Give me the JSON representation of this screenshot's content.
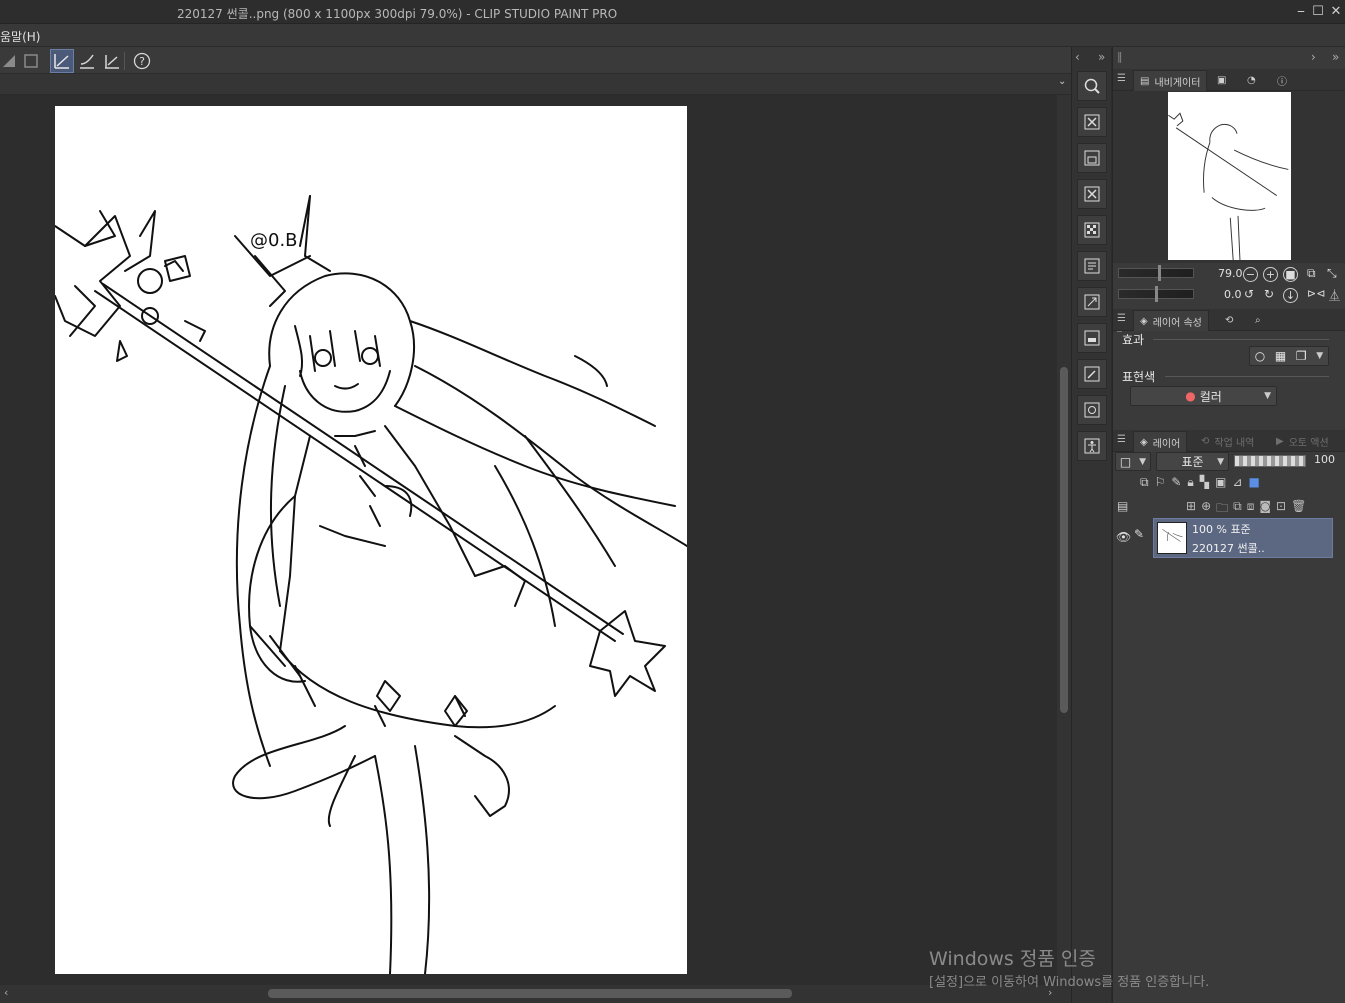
{
  "window": {
    "title": "220127 썬콜..png (800 x 1100px 300dpi 79.0%)  - CLIP STUDIO PAINT PRO",
    "minimize_glyph": "⎯",
    "maximize_glyph": "☐",
    "close_glyph": "✕"
  },
  "menu": {
    "help_label": "움말(H)"
  },
  "toolbar": {
    "icons": [
      "ruler-edge-icon",
      "frame-icon",
      "snap-to-ruler-icon",
      "snap-to-special-ruler-icon",
      "snap-to-grid-icon",
      "help-icon"
    ]
  },
  "navigator": {
    "tabs": [
      {
        "label": "내비게이터",
        "active": true
      },
      {
        "label": "",
        "active": false
      },
      {
        "label": "",
        "active": false
      },
      {
        "label": "",
        "active": false
      }
    ],
    "zoom_value": "79.0",
    "rotation_value": "0.0"
  },
  "layer_property": {
    "tab_label": "레이어 속성",
    "effect_label": "효과",
    "expression_color_label": "표현색",
    "expression_color_value": "컬러"
  },
  "layer_panel": {
    "tabs": [
      {
        "label": "레이어",
        "active": true
      },
      {
        "label": "작업 내역",
        "active": false
      },
      {
        "label": "오토 액션",
        "active": false
      }
    ],
    "blend_mode": "표준",
    "opacity": "100",
    "layers": [
      {
        "opacity_mode": "100 % 표준",
        "name": "220127 썬콜..",
        "visible": true,
        "selected": true
      }
    ]
  },
  "watermark": {
    "line1": "Windows 정품 인증",
    "line2": "[설정]으로 이동하여 Windows를 정품 인증합니다."
  },
  "scroll": {
    "vertical_percent": 39,
    "horizontal_percent": 25
  }
}
